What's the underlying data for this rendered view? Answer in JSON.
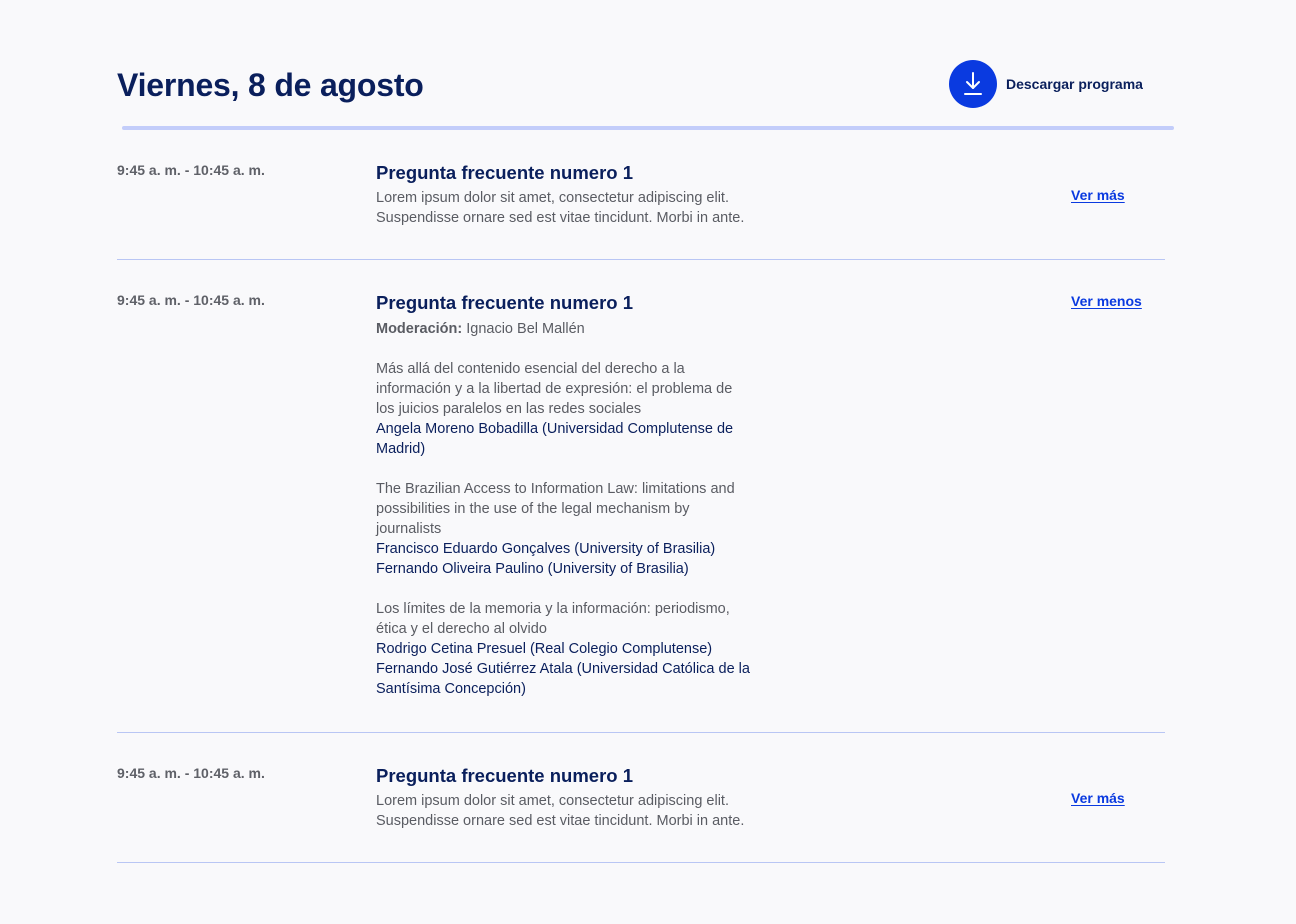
{
  "header": {
    "title": "Viernes, 8 de agosto",
    "download_label": "Descargar programa"
  },
  "sessions": [
    {
      "time": "9:45 a. m. - 10:45 a. m.",
      "title": "Pregunta frecuente numero 1",
      "summary_lines": [
        "Lorem ipsum dolor sit amet, consectetur adipiscing elit.",
        "Suspendisse ornare sed est vitae tincidunt. Morbi in ante."
      ],
      "toggle_label": "Ver más"
    },
    {
      "time": "9:45 a. m. - 10:45 a. m.",
      "title": "Pregunta frecuente numero 1",
      "moderation_label": "Moderación:",
      "moderator": "Ignacio Bel Mallén",
      "toggle_label": "Ver menos",
      "talks": [
        {
          "title_lines": [
            "Más allá del contenido esencial del derecho a la",
            "información y a la libertad de expresión: el problema de",
            "los juicios paralelos en las redes sociales"
          ],
          "speaker_lines": [
            "Angela Moreno Bobadilla (Universidad Complutense de",
            "Madrid)"
          ]
        },
        {
          "title_lines": [
            "The Brazilian Access to Information Law: limitations and",
            "possibilities in the use of the legal mechanism by",
            "journalists"
          ],
          "speaker_lines": [
            "Francisco Eduardo Gonçalves (University of Brasilia)",
            "Fernando Oliveira Paulino (University of Brasilia)"
          ]
        },
        {
          "title_lines": [
            "Los límites de la memoria y la información: periodismo,",
            "ética y el derecho al olvido"
          ],
          "speaker_lines": [
            "Rodrigo Cetina Presuel (Real Colegio Complutense)",
            "Fernando José Gutiérrez Atala (Universidad Católica de la",
            "Santísima Concepción)"
          ]
        }
      ]
    },
    {
      "time": "9:45 a. m. - 10:45 a. m.",
      "title": "Pregunta frecuente numero 1",
      "summary_lines": [
        "Lorem ipsum dolor sit amet, consectetur adipiscing elit.",
        "Suspendisse ornare sed est vitae tincidunt. Morbi in ante."
      ],
      "toggle_label": "Ver más"
    }
  ],
  "colors": {
    "primary": "#0a3ae0",
    "heading": "#0a1f5c",
    "divider": "#b9c6f4",
    "background": "#f9f9fb"
  },
  "icons": {
    "download": "download-icon"
  }
}
